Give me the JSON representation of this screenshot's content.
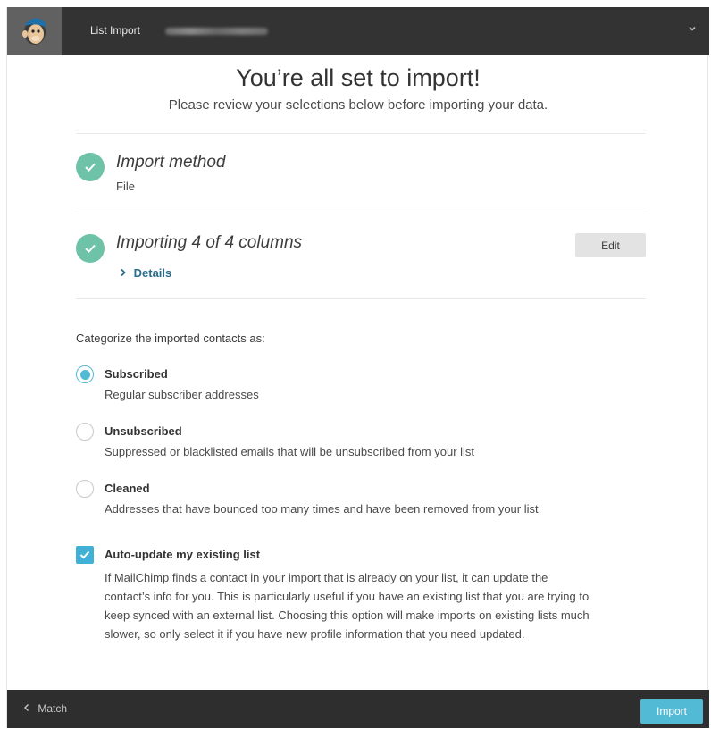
{
  "topbar": {
    "title": "List Import",
    "logo_icon": "mailchimp-logo-icon",
    "menu_icon": "chevron-down-icon"
  },
  "header": {
    "title": "You’re all set to import!",
    "subtitle": "Please review your selections below before importing your data."
  },
  "steps": [
    {
      "title": "Import method",
      "value": "File"
    },
    {
      "title": "Importing 4 of 4 columns",
      "link": "Details",
      "edit_label": "Edit"
    }
  ],
  "categorize": {
    "heading": "Categorize the imported contacts as:",
    "selected": "Subscribed",
    "options": [
      {
        "label": "Subscribed",
        "description": "Regular subscriber addresses"
      },
      {
        "label": "Unsubscribed",
        "description": "Suppressed or blacklisted emails that will be unsubscribed from your list"
      },
      {
        "label": "Cleaned",
        "description": "Addresses that have bounced too many times and have been removed from your list"
      }
    ]
  },
  "auto_update": {
    "checked": true,
    "label": "Auto-update my existing list",
    "description": "If MailChimp finds a contact in your import that is already on your list, it can update the contact’s info for you. This is particularly useful if you have an existing list that you are trying to keep synced with an external list. Choosing this option will make imports on existing lists much slower, so only select it if you have new profile information that you need updated."
  },
  "footer": {
    "back_label": "Match",
    "import_label": "Import"
  },
  "colors": {
    "accent": "#52bad5",
    "success": "#6dc2a8",
    "dark_bar": "#333333"
  }
}
